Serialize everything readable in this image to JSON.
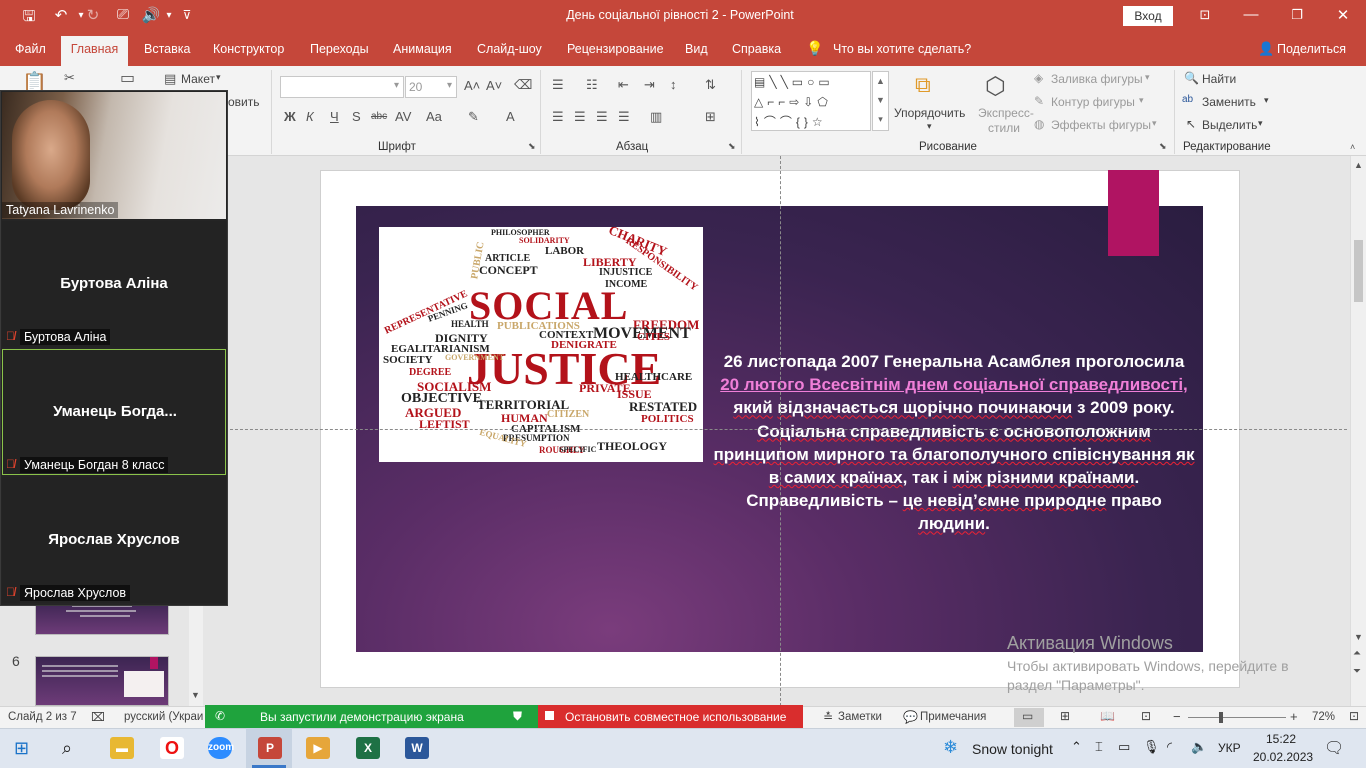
{
  "window": {
    "title": "День соціальної рівності 2  -  PowerPoint",
    "login_button": "Вход"
  },
  "ribbon_tabs": [
    "Файл",
    "Главная",
    "Вставка",
    "Конструктор",
    "Переходы",
    "Анимация",
    "Слайд-шоу",
    "Рецензирование",
    "Вид",
    "Справка"
  ],
  "active_tab": "Главная",
  "tell_me": "Что вы хотите сделать?",
  "share": "Поделиться",
  "ribbon": {
    "slides_group": {
      "layout": "Макет",
      "restore_partial": "овить"
    },
    "font_group": {
      "label": "Шрифт",
      "font_size": "20"
    },
    "paragraph_group": {
      "label": "Абзац"
    },
    "drawing_group": {
      "label": "Рисование",
      "arrange": "Упорядочить",
      "quick_styles": "Экспресс-стили",
      "shape_fill": "Заливка фигуры",
      "shape_outline": "Контур фигуры",
      "shape_effects": "Эффекты фигуры"
    },
    "editing_group": {
      "label": "Редактирование",
      "find": "Найти",
      "replace": "Заменить",
      "select": "Выделить"
    }
  },
  "slide": {
    "word_cloud": {
      "main_1": "SOCIAL",
      "main_2": "JUSTICE",
      "words": [
        "PHILOSOPHER",
        "SOLIDARITY",
        "CHARITY",
        "LABOR",
        "LIBERTY",
        "RESPONSIBILITY",
        "ARTICLE",
        "CONCEPT",
        "INJUSTICE",
        "PUBLIC",
        "INCOME",
        "FREEDOM",
        "PUBLICATIONS",
        "MOVEMENT",
        "CITES",
        "HEALTH",
        "REPRESENTATIVE",
        "PENNING",
        "DIGNITY",
        "CONTEXT",
        "DENIGRATE",
        "EGALITARIANISM",
        "SOCIETY",
        "DEGREE",
        "SOCIALISM",
        "PRIVATE",
        "HEALTHCARE",
        "OBJECTIVE",
        "TERRITORIAL",
        "HUMAN",
        "ISSUE",
        "RESTATED",
        "ARGUED",
        "CITIZEN",
        "CAPITALISM",
        "POLITICS",
        "LEFTIST",
        "PRESUMPTION",
        "THEOLOGY",
        "EQUALITY",
        "ROUGHLY",
        "GOVERNMENT",
        "SPECIFIC",
        "HEALTHCARE"
      ]
    },
    "text_p1_a": "26 листопада 2007 Генеральна Асамблея проголосила ",
    "text_p1_link": "20 лютого Всесвітнім днем соціальної справедливості,",
    "text_p1_b1": " ",
    "text_p1_w1": "який",
    "text_p1_w2": "відзначається щорічно починаючи",
    "text_p1_b2": " з 2009 року.",
    "text_p2_w1": "Соціальна справедливість є основоположним принципом мирного та благополучного співіснування як в самих країнах",
    "text_p2_b1": ", так і ",
    "text_p2_w2": "між різними країнами",
    "text_p2_b2": ". Справедливість – ",
    "text_p2_w3": "це невід’ємне природне",
    "text_p2_b3": " право ",
    "text_p2_w4": "людини",
    "text_p2_b4": "."
  },
  "thumbnails": {
    "slide6_number": "6"
  },
  "zoom_participants": [
    {
      "name": "Tatyana Lavrinenko",
      "video": true
    },
    {
      "display": "Буртова Аліна",
      "label": "Буртова Аліна",
      "muted": true
    },
    {
      "display": "Уманець  Богда...",
      "label": "Уманець Богдан 8 класс",
      "muted": true,
      "active": true
    },
    {
      "display": "Ярослав Хруслов",
      "label": "Ярослав Хруслов",
      "muted": true
    }
  ],
  "statusbar": {
    "slide_count": "Слайд 2 из 7",
    "language": "русский (Украи",
    "notes": "Заметки",
    "comments": "Примечания",
    "zoom": "72%"
  },
  "sharing": {
    "status": "Вы запустили демонстрацию экрана",
    "stop": "Остановить совместное использование"
  },
  "activation": {
    "title": "Активация Windows",
    "line1": "Чтобы активировать Windows, перейдите в",
    "line2": "раздел \"Параметры\"."
  },
  "taskbar": {
    "weather": "Snow tonight",
    "lang": "УКР",
    "time": "15:22",
    "date": "20.02.2023"
  },
  "colors": {
    "accent": "#c5473a",
    "share_green": "#1fa33d",
    "share_red": "#d92d2d",
    "slide_link": "#f07fd8",
    "magenta": "#b01462"
  }
}
